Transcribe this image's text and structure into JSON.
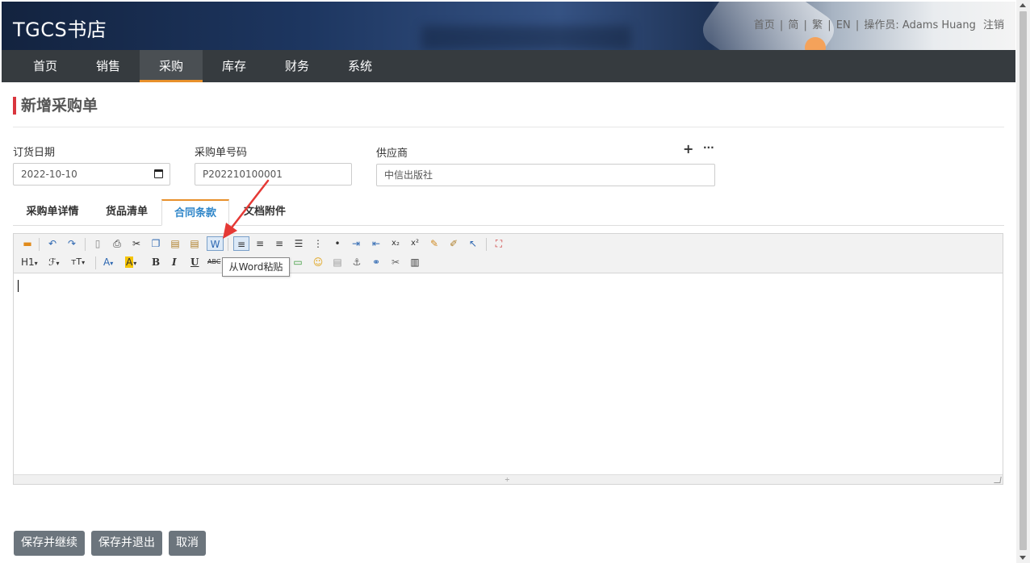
{
  "header": {
    "brand": "TGCS书店",
    "links": {
      "home": "首页",
      "simplified": "简",
      "traditional": "繁",
      "english": "EN",
      "operator_label": "操作员:",
      "operator_name": "Adams Huang",
      "logout": "注销",
      "sep": "|"
    }
  },
  "nav": {
    "items": [
      {
        "label": "首页"
      },
      {
        "label": "销售"
      },
      {
        "label": "采购"
      },
      {
        "label": "库存"
      },
      {
        "label": "财务"
      },
      {
        "label": "系统"
      }
    ],
    "active": "采购"
  },
  "page": {
    "title": "新增采购单"
  },
  "form": {
    "order_date": {
      "label": "订货日期",
      "value": "2022-10-10"
    },
    "po_number": {
      "label": "采购单号码",
      "value": "P202210100001"
    },
    "supplier": {
      "label": "供应商",
      "value": "中信出版社",
      "add_icon": "+",
      "more_icon": "···"
    }
  },
  "tabs": [
    {
      "label": "采购单详情"
    },
    {
      "label": "货品清单"
    },
    {
      "label": "合同条款"
    },
    {
      "label": "文档附件"
    }
  ],
  "active_tab": "合同条款",
  "editor": {
    "toolbar_text": {
      "heading": "H1",
      "font_family": "ℱ",
      "font_size": "тT",
      "font_color": "A",
      "bg_color": "A",
      "bold": "B",
      "italic": "I",
      "underline": "U",
      "strike": "ABC"
    },
    "tooltip": "从Word粘贴",
    "content": ""
  },
  "buttons": {
    "save_continue": "保存并继续",
    "save_exit": "保存并退出",
    "cancel": "取消"
  },
  "colors": {
    "nav_bg": "#363b3f",
    "accent": "#e8902b",
    "title_bar": "#d9363e",
    "button": "#6c757d",
    "active_tab_text": "#2f86c9"
  }
}
